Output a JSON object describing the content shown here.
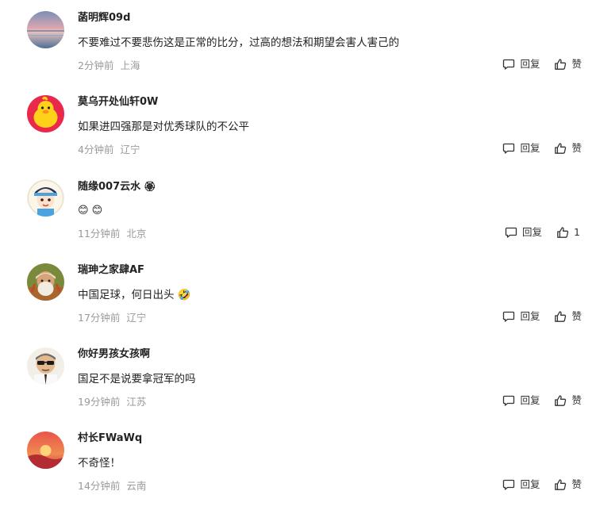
{
  "comments": [
    {
      "username": "菡明辉09d",
      "badge": "",
      "text": "不要难过不要悲伤这是正常的比分，过高的想法和期望会害人害己的",
      "time": "2分钟前",
      "location": "上海",
      "reply_label": "回复",
      "like_label": "赞",
      "avatar": "sunset-lake"
    },
    {
      "username": "莫乌开处仙轩0W",
      "badge": "",
      "text": "如果进四强那是对优秀球队的不公平",
      "time": "4分钟前",
      "location": "辽宁",
      "reply_label": "回复",
      "like_label": "赞",
      "avatar": "yellow-duck"
    },
    {
      "username": "随缘007云水",
      "badge": "🏵",
      "text": "😊 😊",
      "time": "11分钟前",
      "location": "北京",
      "reply_label": "回复",
      "like_label": "1",
      "avatar": "cartoon-boy"
    },
    {
      "username": "瑞珅之家肆AF",
      "badge": "",
      "text": "中国足球，何日出头 🤣",
      "time": "17分钟前",
      "location": "辽宁",
      "reply_label": "回复",
      "like_label": "赞",
      "avatar": "old-man"
    },
    {
      "username": "你好男孩女孩啊",
      "badge": "",
      "text": "国足不是说要拿冠军的吗",
      "time": "19分钟前",
      "location": "江苏",
      "reply_label": "回复",
      "like_label": "赞",
      "avatar": "sunglasses-man"
    },
    {
      "username": "村长FWaWq",
      "badge": "",
      "text": "不奇怪！",
      "time": "14分钟前",
      "location": "云南",
      "reply_label": "回复",
      "like_label": "赞",
      "avatar": "sunset-sky"
    }
  ],
  "colors": {
    "text": "#222222",
    "meta": "#9a9a9a",
    "action": "#333333"
  }
}
